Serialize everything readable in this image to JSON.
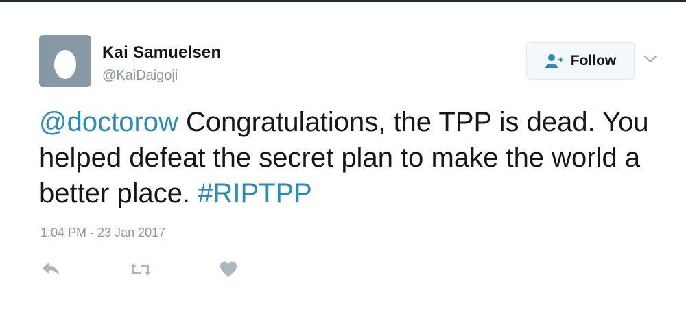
{
  "author": {
    "name": "Kai Samuelsen",
    "handle": "@KaiDaigoji",
    "avatar_icon": "default-egg-avatar"
  },
  "follow_button": {
    "label": "Follow",
    "icon": "add-user-icon"
  },
  "tweet": {
    "mention": "@doctorow",
    "text": " Congratulations, the TPP is dead. You helped defeat the secret plan to make the world a better place. ",
    "hashtag": "#RIPTPP",
    "timestamp": "1:04 PM - 23 Jan 2017"
  },
  "actions": {
    "reply_icon": "reply-icon",
    "retweet_icon": "retweet-icon",
    "like_icon": "heart-icon"
  },
  "colors": {
    "link": "#2a8ab8",
    "text": "#14171a",
    "muted": "#8b98a5",
    "icon": "#aab8c2",
    "follow_icon": "#2a8ab8"
  }
}
